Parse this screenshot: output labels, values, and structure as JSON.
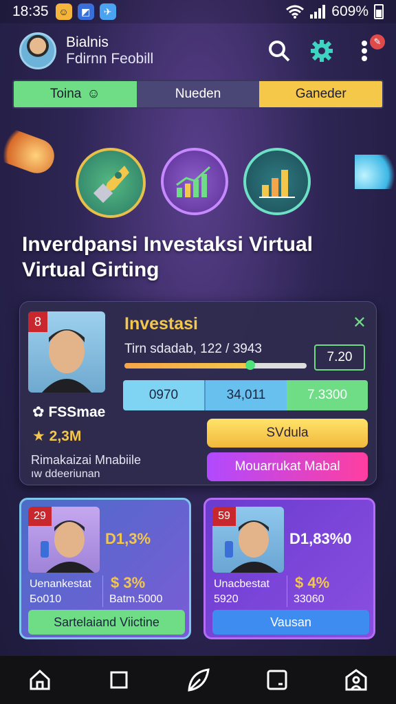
{
  "status_bar": {
    "time": "18:35",
    "battery": "609%",
    "icons": [
      "app-notification-icon",
      "app-square-icon",
      "app-plane-icon",
      "wifi-icon",
      "signal-icon",
      "battery-icon"
    ]
  },
  "header": {
    "user_name": "Bialnis",
    "user_subtitle": "Fdirnn Feobill",
    "notification_badge_icon": "alert-icon"
  },
  "tabs": [
    {
      "label": "Toina",
      "color": "#6fdc86"
    },
    {
      "label": "Nueden",
      "color": "#4a4777"
    },
    {
      "label": "Ganeder",
      "color": "#f6c84a"
    }
  ],
  "hero": {
    "title": "Inverdpansi Investaksi Virtual Virtual Girting",
    "icons": [
      "rocket-icon",
      "growth-chart-icon",
      "bar-chart-icon"
    ]
  },
  "main_card": {
    "rank": "8",
    "title": "Investasi",
    "progress_text": "Tirn sdadab, 122 / 3943",
    "progress_fraction": 0.69,
    "value": "7.20",
    "stats": [
      "0970",
      "34,011",
      "7.3300"
    ],
    "name": "FSSmae",
    "coins": "2,3M",
    "desc_line1": "Rimakaizai Mnabiile",
    "desc_line2": "ıw ddeeriunan",
    "button_primary": "SVdula",
    "button_secondary": "Mouarrukat Mabal"
  },
  "cards": [
    {
      "rank": "29",
      "percent": "D1,3%",
      "label1": "Uenankestat",
      "label2": "Бо010",
      "money": "$ 3%",
      "sub": "Batm.5000",
      "button": "Sartelaiand Viictine"
    },
    {
      "rank": "59",
      "percent": "D1,83%0",
      "label1": "Unacbestat",
      "label2": "5920",
      "money": "$ 4%",
      "sub": "33060",
      "button": "Vausan"
    }
  ],
  "navbar": {
    "icons": [
      "home-icon",
      "square-icon",
      "leaf-icon",
      "tab-icon",
      "profile-icon"
    ]
  },
  "colors": {
    "accent_green": "#6fdc86",
    "accent_yellow": "#f3c74b",
    "badge_red": "#c8272d"
  }
}
